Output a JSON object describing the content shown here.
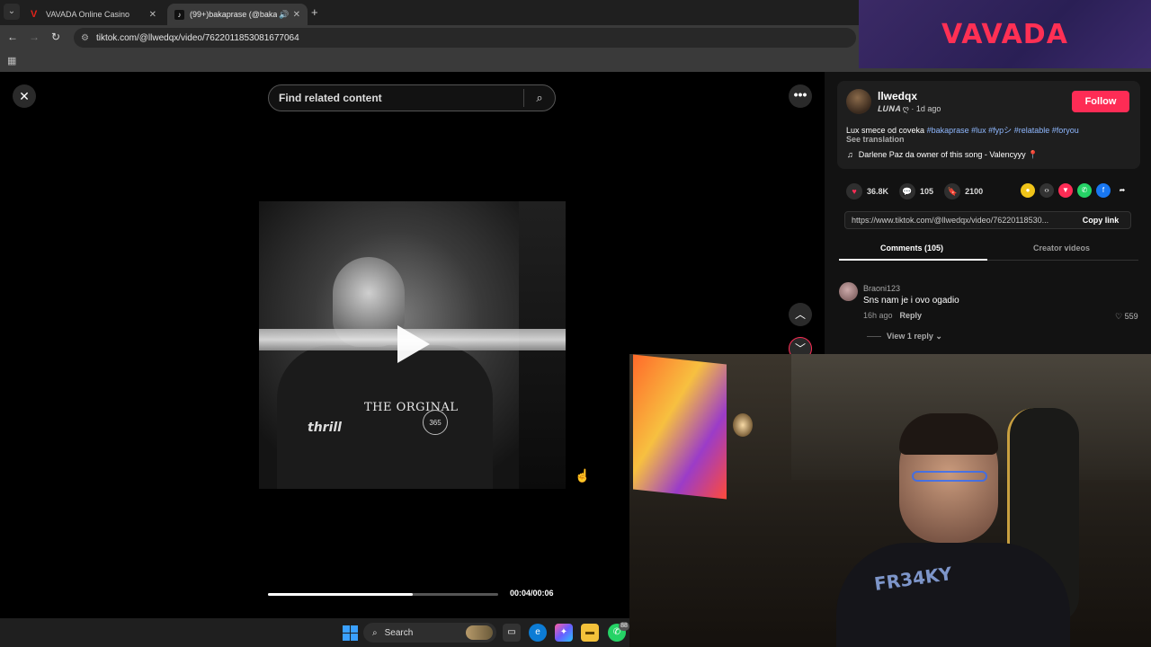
{
  "browser": {
    "tabs": [
      {
        "title": "VAVADA Online Casino",
        "favicon": "vavada-favicon-icon",
        "active": false
      },
      {
        "title": "(99+)bakaprase (@bakapra",
        "favicon": "tiktok-favicon-icon",
        "active": true
      }
    ],
    "url": "tiktok.com/@llwedqx/video/7622011853081677064"
  },
  "ad_banner": {
    "brand": "VAVADA",
    "color": "#ff3054"
  },
  "video": {
    "search_placeholder": "Find related content",
    "overlay_text": "THE ORGINAL",
    "logo_text": "365",
    "shirt_text": "thrill",
    "progress": 0.63,
    "time": "00:04/00:06"
  },
  "post": {
    "username": "llwedqx",
    "nickname": "𝑳𝑼𝑵𝑨 ღ",
    "posted": "· 1d ago",
    "follow_label": "Follow",
    "description": "Lux smece od coveka ",
    "hashtags": [
      "#bakaprase",
      "#lux",
      "#fypシ",
      "#relatable",
      "#foryou"
    ],
    "see_translation": "See translation",
    "music": "Darlene Paz da owner of this song - Valencyyy",
    "likes": "36.8K",
    "comments_count": "105",
    "saves": "2100",
    "share_link": "https://www.tiktok.com/@llwedqx/video/76220118530...",
    "copy_link_label": "Copy link",
    "tab_comments": "Comments (105)",
    "tab_creator": "Creator videos",
    "accent": "#fe2c55"
  },
  "comment": {
    "user": "Braoni123",
    "text": "Sns nam je i ovo ogadio",
    "time": "16h ago",
    "reply_label": "Reply",
    "likes": "559",
    "view_replies": "View 1 reply"
  },
  "webcam": {
    "shirt_logo": "FR34KY"
  },
  "taskbar": {
    "search_label": "Search",
    "whatsapp_badge": "88"
  }
}
